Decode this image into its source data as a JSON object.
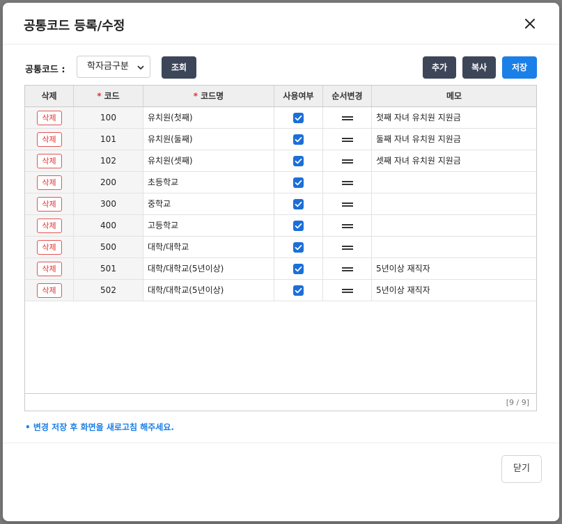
{
  "modal": {
    "title": "공통코드 등록/수정",
    "close_label": "닫기",
    "notice": "• 변경 저장 후 화면을 새로고침 해주세요."
  },
  "filter": {
    "label": "공통코드 :",
    "selected": "학자금구분"
  },
  "toolbar": {
    "search_label": "조회",
    "add_label": "추가",
    "copy_label": "복사",
    "save_label": "저장"
  },
  "table": {
    "headers": {
      "delete": "삭제",
      "required_mark": "*",
      "code": "코드",
      "code_name": "코드명",
      "use": "사용여부",
      "order": "순서변경",
      "memo": "메모"
    },
    "delete_label": "삭제",
    "rows": [
      {
        "code": "100",
        "name": "유치원(첫째)",
        "use": true,
        "memo": "첫째 자녀 유치원 지원금"
      },
      {
        "code": "101",
        "name": "유치원(둘째)",
        "use": true,
        "memo": "둘째 자녀 유치원 지원금"
      },
      {
        "code": "102",
        "name": "유치원(셋째)",
        "use": true,
        "memo": "셋째 자녀 유치원 지원금"
      },
      {
        "code": "200",
        "name": "초등학교",
        "use": true,
        "memo": ""
      },
      {
        "code": "300",
        "name": "중학교",
        "use": true,
        "memo": ""
      },
      {
        "code": "400",
        "name": "고등학교",
        "use": true,
        "memo": ""
      },
      {
        "code": "500",
        "name": "대학/대학교",
        "use": true,
        "memo": ""
      },
      {
        "code": "501",
        "name": "대학/대학교(5년이상)",
        "use": true,
        "memo": "5년이상 재직자"
      },
      {
        "code": "502",
        "name": "대학/대학교(5년이상)",
        "use": true,
        "memo": "5년이상 재직자"
      }
    ],
    "pager": "[9 / 9]"
  },
  "icons": {
    "close": "close-icon",
    "caret": "chevron-down-icon",
    "check": "checkbox-checked-icon",
    "drag": "drag-handle-icon"
  },
  "colors": {
    "primary": "#1b7fe8",
    "dark_button": "#3d4659",
    "delete_red": "#e03131",
    "checkbox": "#1b6fd8"
  }
}
